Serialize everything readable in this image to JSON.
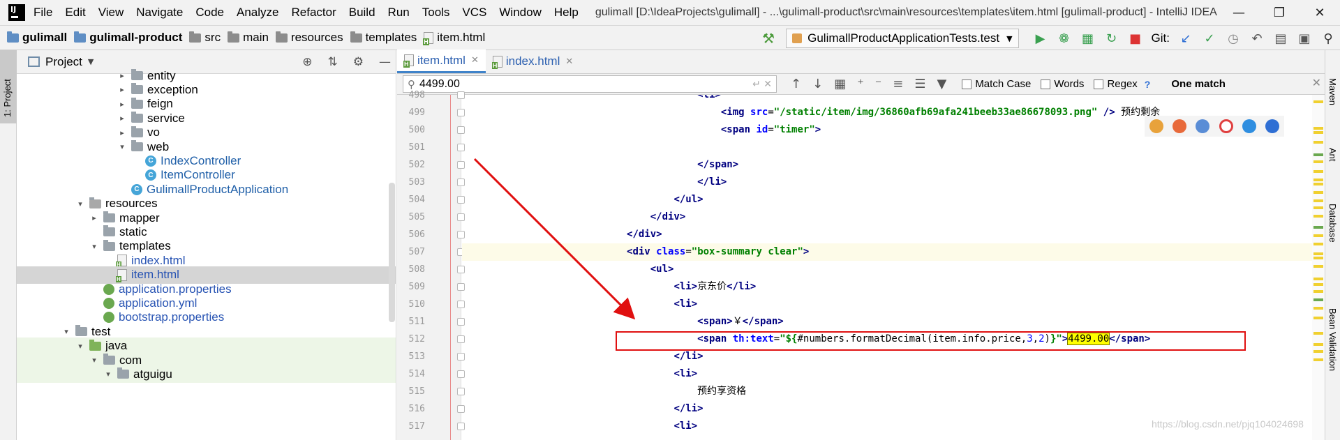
{
  "menubar": {
    "items": [
      "File",
      "Edit",
      "View",
      "Navigate",
      "Code",
      "Analyze",
      "Refactor",
      "Build",
      "Run",
      "Tools",
      "VCS",
      "Window",
      "Help"
    ],
    "window_title": "gulimall [D:\\IdeaProjects\\gulimall] - ...\\gulimall-product\\src\\main\\resources\\templates\\item.html [gulimall-product] - IntelliJ IDEA"
  },
  "breadcrumb": [
    "gulimall",
    "gulimall-product",
    "src",
    "main",
    "resources",
    "templates",
    "item.html"
  ],
  "run_config": "GulimallProductApplicationTests.test",
  "vcs_label": "Git:",
  "project_panel": {
    "title": "Project",
    "tree": [
      {
        "label": "entity",
        "indent": 4,
        "type": "folder",
        "arrow": ">"
      },
      {
        "label": "exception",
        "indent": 4,
        "type": "folder",
        "arrow": ">"
      },
      {
        "label": "feign",
        "indent": 4,
        "type": "folder",
        "arrow": ">"
      },
      {
        "label": "service",
        "indent": 4,
        "type": "folder",
        "arrow": ">"
      },
      {
        "label": "vo",
        "indent": 4,
        "type": "folder",
        "arrow": ">"
      },
      {
        "label": "web",
        "indent": 4,
        "type": "folder",
        "arrow": "v"
      },
      {
        "label": "IndexController",
        "indent": 5,
        "type": "class"
      },
      {
        "label": "ItemController",
        "indent": 5,
        "type": "class"
      },
      {
        "label": "GulimallProductApplication",
        "indent": 4,
        "type": "app"
      },
      {
        "label": "resources",
        "indent": 1,
        "type": "res",
        "arrow": "v"
      },
      {
        "label": "mapper",
        "indent": 2,
        "type": "folder",
        "arrow": ">"
      },
      {
        "label": "static",
        "indent": 2,
        "type": "folder"
      },
      {
        "label": "templates",
        "indent": 2,
        "type": "folder",
        "arrow": "v"
      },
      {
        "label": "index.html",
        "indent": 3,
        "type": "html"
      },
      {
        "label": "item.html",
        "indent": 3,
        "type": "html",
        "selected": true
      },
      {
        "label": "application.properties",
        "indent": 2,
        "type": "prop"
      },
      {
        "label": "application.yml",
        "indent": 2,
        "type": "prop"
      },
      {
        "label": "bootstrap.properties",
        "indent": 2,
        "type": "prop"
      },
      {
        "label": "test",
        "indent": 0,
        "type": "folder",
        "arrow": "v"
      },
      {
        "label": "java",
        "indent": 1,
        "type": "green",
        "arrow": "v",
        "green": true
      },
      {
        "label": "com",
        "indent": 2,
        "type": "folder",
        "arrow": "v",
        "green": true
      },
      {
        "label": "atguigu",
        "indent": 3,
        "type": "folder",
        "arrow": "v",
        "green": true
      }
    ]
  },
  "tabs": [
    {
      "label": "item.html",
      "active": true
    },
    {
      "label": "index.html",
      "active": false
    }
  ],
  "search": {
    "value": "4499.00",
    "options": [
      "Match Case",
      "Words",
      "Regex"
    ],
    "help": "?",
    "result": "One match"
  },
  "editor": {
    "lines": [
      {
        "n": "498",
        "html": "                                        <span class=\"kw\">&lt;li&gt;</span>"
      },
      {
        "n": "499",
        "html": "                                            <span class=\"kw\">&lt;img </span><span class=\"at\">src</span>=<span class=\"str\">\"/static/item/img/36860afb69afa241beeb33ae86678093.png\"</span> <span class=\"kw\">/&gt;</span> 预约剩余"
      },
      {
        "n": "500",
        "html": "                                            <span class=\"kw\">&lt;span </span><span class=\"at\">id</span>=<span class=\"str\">\"timer\"</span><span class=\"kw\">&gt;</span>"
      },
      {
        "n": "501",
        "html": ""
      },
      {
        "n": "502",
        "html": "                                        <span class=\"kw\">&lt;/span&gt;</span>"
      },
      {
        "n": "503",
        "html": "                                        <span class=\"kw\">&lt;/li&gt;</span>"
      },
      {
        "n": "504",
        "html": "                                    <span class=\"kw\">&lt;/ul&gt;</span>"
      },
      {
        "n": "505",
        "html": "                                <span class=\"kw\">&lt;/div&gt;</span>"
      },
      {
        "n": "506",
        "html": "                            <span class=\"kw\">&lt;/div&gt;</span>"
      },
      {
        "n": "507",
        "html": "                            <span class=\"kw\">&lt;div </span><span class=\"at\">class</span>=<span class=\"str\">\"box-summary clear\"</span><span class=\"kw\">&gt;</span>",
        "current": true
      },
      {
        "n": "508",
        "html": "                                <span class=\"kw\">&lt;ul&gt;</span>"
      },
      {
        "n": "509",
        "html": "                                    <span class=\"kw\">&lt;li&gt;</span>京东价<span class=\"kw\">&lt;/li&gt;</span>"
      },
      {
        "n": "510",
        "html": "                                    <span class=\"kw\">&lt;li&gt;</span>"
      },
      {
        "n": "511",
        "html": "                                        <span class=\"kw\">&lt;span&gt;</span>￥<span class=\"kw\">&lt;/span&gt;</span>"
      },
      {
        "n": "512",
        "html": "                                        <span class=\"kw\">&lt;span </span><span class=\"at\">th:text</span>=<span class=\"str\">\"${</span>#numbers.formatDecimal(item.info.price,<span class=\"num\">3</span>,<span class=\"num\">2</span>)<span class=\"str\">}\"</span><span class=\"kw\">&gt;</span><span class=\"hl\">4499.00</span><span class=\"kw\">&lt;/span&gt;</span>"
      },
      {
        "n": "513",
        "html": "                                    <span class=\"kw\">&lt;/li&gt;</span>"
      },
      {
        "n": "514",
        "html": "                                    <span class=\"kw\">&lt;li&gt;</span>"
      },
      {
        "n": "515",
        "html": "                                        预约享资格"
      },
      {
        "n": "516",
        "html": "                                    <span class=\"kw\">&lt;/li&gt;</span>"
      },
      {
        "n": "517",
        "html": "                                    <span class=\"kw\">&lt;li&gt;</span>"
      }
    ]
  },
  "right_tools": [
    "Maven",
    "Ant",
    "Database",
    "Bean Validation"
  ],
  "left_tool": "1: Project",
  "watermark": "https://blog.csdn.net/pjq104024698",
  "colors": {
    "highlight_box": "#e01010",
    "arrow": "#e01010",
    "search_highlight": "#ffff00"
  }
}
